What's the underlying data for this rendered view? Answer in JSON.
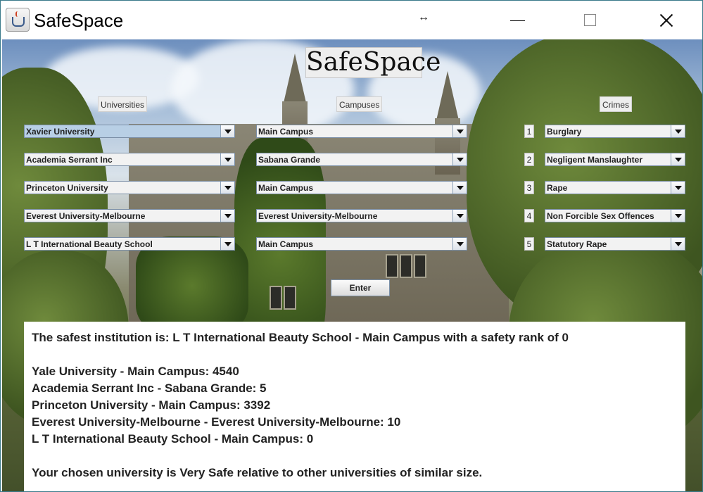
{
  "window": {
    "title": "SafeSpace",
    "resize_glyph": "↔",
    "icon": "java-cup-icon"
  },
  "header": {
    "logo_text": "SafeSpace"
  },
  "columns": {
    "universities_label": "Universities",
    "campuses_label": "Campuses",
    "crimes_label": "Crimes"
  },
  "rows": [
    {
      "university": "Xavier University",
      "campus": "Main Campus",
      "number": "1",
      "crime": "Burglary"
    },
    {
      "university": "Academia Serrant Inc",
      "campus": "Sabana Grande",
      "number": "2",
      "crime": "Negligent Manslaughter"
    },
    {
      "university": "Princeton University",
      "campus": "Main Campus",
      "number": "3",
      "crime": "Rape"
    },
    {
      "university": "Everest University-Melbourne",
      "campus": "Everest University-Melbourne",
      "number": "4",
      "crime": "Non Forcible Sex Offences"
    },
    {
      "university": "L T International Beauty School",
      "campus": "Main Campus",
      "number": "5",
      "crime": "Statutory Rape"
    }
  ],
  "enter_button": "Enter",
  "results": {
    "safest": "The safest institution is: L T International Beauty School - Main Campus with a safety rank of 0",
    "lines": [
      "Yale University - Main Campus: 4540",
      "Academia Serrant Inc - Sabana Grande: 5",
      "Princeton University - Main Campus: 3392",
      "Everest University-Melbourne - Everest University-Melbourne: 10",
      "L T International Beauty School - Main Campus: 0"
    ],
    "verdict": "Your chosen university is Very Safe relative to other universities of similar size."
  }
}
